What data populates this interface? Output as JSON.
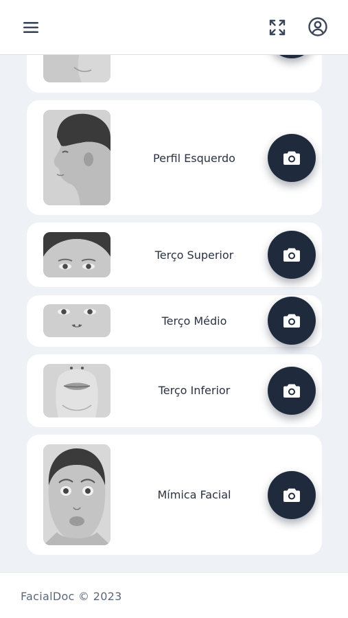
{
  "header": {
    "menu_icon": "hamburger-menu-icon",
    "expand_icon": "fullscreen-expand-icon",
    "profile_icon": "user-circle-icon"
  },
  "cards": [
    {
      "label": "",
      "camera_icon": "camera-icon"
    },
    {
      "label": "Perfil Esquerdo",
      "camera_icon": "camera-icon"
    },
    {
      "label": "Terço Superior",
      "camera_icon": "camera-icon"
    },
    {
      "label": "Terço Médio",
      "camera_icon": "camera-icon"
    },
    {
      "label": "Terço Inferior",
      "camera_icon": "camera-icon"
    },
    {
      "label": "Mímica Facial",
      "camera_icon": "camera-icon"
    }
  ],
  "footer": {
    "text": "FacialDoc © 2023"
  },
  "colors": {
    "primary": "#1f2a3d",
    "background": "#eef2f7",
    "card": "#ffffff"
  }
}
